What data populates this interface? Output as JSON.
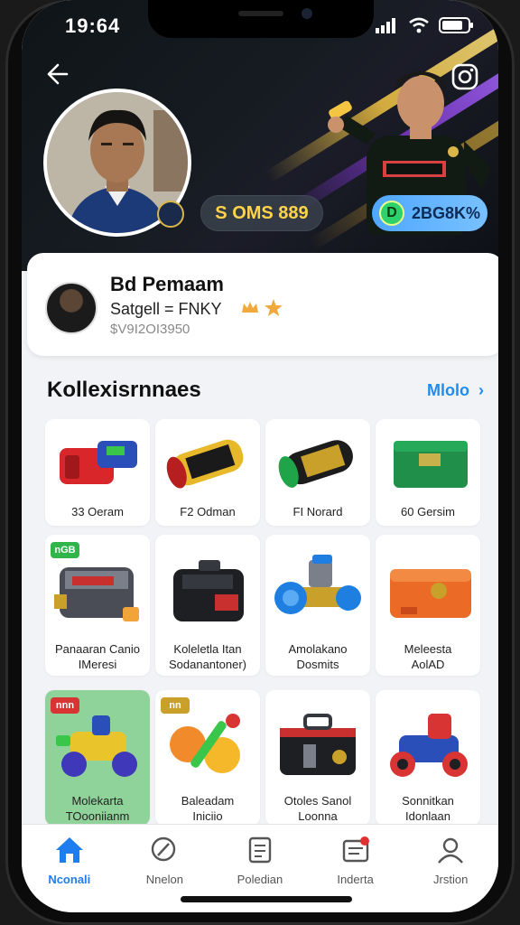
{
  "status": {
    "time": "19:64"
  },
  "header": {
    "coin_balance": "S OMS 889",
    "gem_balance": "2BG8K%",
    "gem_icon_text": "D"
  },
  "profile": {
    "name": "Bd Pemaam",
    "subtitle": "Satgell = FNKY",
    "id_text": "$V9I2OI3950"
  },
  "collection": {
    "title": "Kollexisrnnaes",
    "link": "Mlolo",
    "items": [
      {
        "label": "33 Oeram",
        "tag": ""
      },
      {
        "label": "F2 Odman",
        "tag": ""
      },
      {
        "label": "FI Norard",
        "tag": ""
      },
      {
        "label": "60 Gersim",
        "tag": ""
      },
      {
        "label": "Panaaran Canio\nIMeresi",
        "tag": "nGB"
      },
      {
        "label": "Koleletla Itan\nSodanantoner)",
        "tag": ""
      },
      {
        "label": "Amolakano\nDosmits",
        "tag": ""
      },
      {
        "label": "Meleesta\nAolAD",
        "tag": ""
      },
      {
        "label": "Molekarta\nTOooniianm",
        "tag": "nnn"
      },
      {
        "label": "Baleadam\nIniciio",
        "tag": "nn"
      },
      {
        "label": "Otoles Sanol\nLoonna",
        "tag": ""
      },
      {
        "label": "Sonnitkan\nIdonlaan",
        "tag": ""
      }
    ]
  },
  "nav": [
    {
      "label": "Nconali",
      "icon": "home-icon",
      "active": true
    },
    {
      "label": "Nnelon",
      "icon": "search-icon",
      "active": false
    },
    {
      "label": "Poledian",
      "icon": "document-icon",
      "active": false
    },
    {
      "label": "Inderta",
      "icon": "inbox-icon",
      "active": false
    },
    {
      "label": "Jrstion",
      "icon": "profile-icon",
      "active": false
    }
  ],
  "colors": {
    "accent": "#1e7ef0",
    "coin": "#ffd34a",
    "gem_pill": "#4fa7ff"
  }
}
